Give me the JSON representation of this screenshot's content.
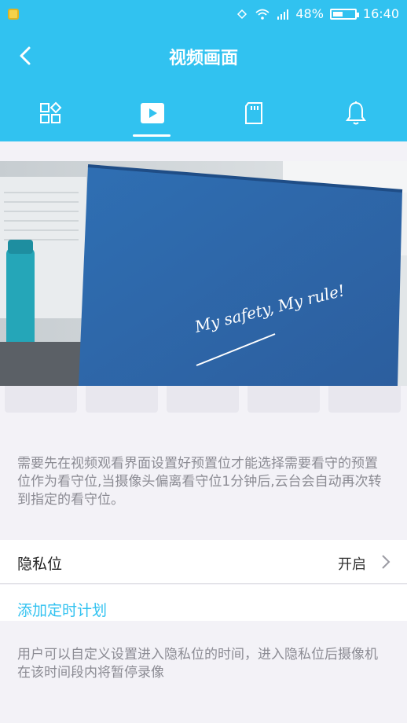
{
  "status_bar": {
    "battery_percent": "48%",
    "battery_level": 0.48,
    "time": "16:40"
  },
  "header": {
    "title": "视频画面"
  },
  "tabs": [
    {
      "icon": "grid-icon"
    },
    {
      "icon": "play-icon",
      "active": true
    },
    {
      "icon": "sd-card-icon"
    },
    {
      "icon": "bell-icon"
    }
  ],
  "video": {
    "overlay_text": "My safety, My rule!"
  },
  "presets": {
    "count": 5
  },
  "description_1": "需要先在视频观看界面设置好预置位才能选择需要看守的预置位作为看守位,当摄像头偏离看守位1分钟后,云台会自动再次转到指定的看守位。",
  "privacy_row": {
    "label": "隐私位",
    "value": "开启"
  },
  "add_schedule_label": "添加定时计划",
  "description_2": "用户可以自定义设置进入隐私位的时间，进入隐私位后摄像机在该时间段内将暂停录像",
  "colors": {
    "accent": "#31c2f0",
    "background": "#f3f2f7",
    "muted_text": "#8b8b93"
  }
}
